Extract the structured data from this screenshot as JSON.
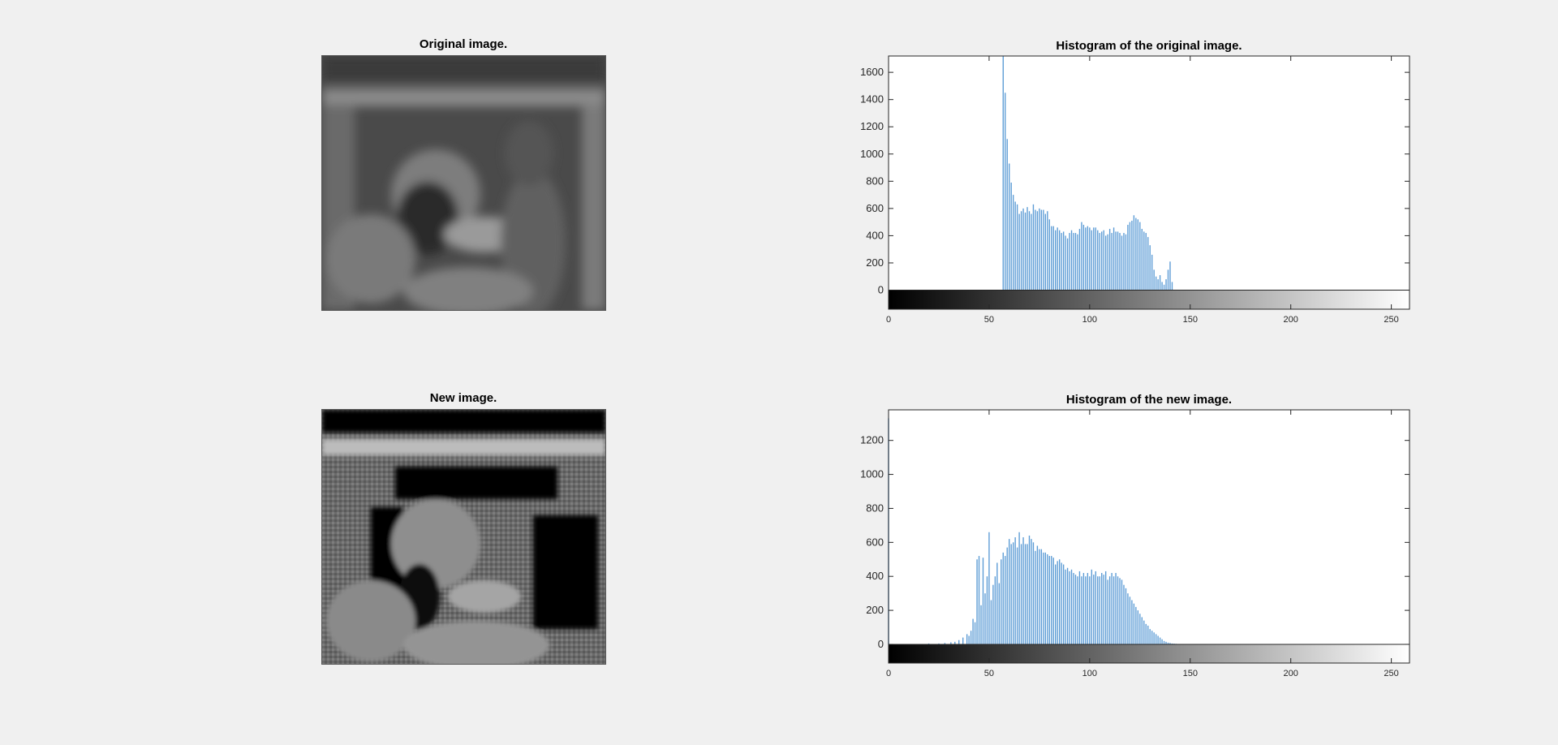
{
  "figure": {
    "original_title": "Original image.",
    "new_title": "New image."
  },
  "chart_data": [
    {
      "type": "bar",
      "title": "Histogram of the original image.",
      "xlabel": "",
      "ylabel": "",
      "xlim": [
        0,
        255
      ],
      "ylim": [
        -140,
        1720
      ],
      "yticks": [
        0,
        200,
        400,
        600,
        800,
        1000,
        1200,
        1400,
        1600
      ],
      "xticks": [
        0,
        50,
        100,
        150,
        200,
        250
      ],
      "bar_color": "#5b9bd5",
      "grid": false,
      "colorbar": "gray (0=black, 255=white)",
      "x": [
        57,
        58,
        59,
        60,
        61,
        62,
        63,
        64,
        65,
        66,
        67,
        68,
        69,
        70,
        71,
        72,
        73,
        74,
        75,
        76,
        77,
        78,
        79,
        80,
        81,
        82,
        83,
        84,
        85,
        86,
        87,
        88,
        89,
        90,
        91,
        92,
        93,
        94,
        95,
        96,
        97,
        98,
        99,
        100,
        101,
        102,
        103,
        104,
        105,
        106,
        107,
        108,
        109,
        110,
        111,
        112,
        113,
        114,
        115,
        116,
        117,
        118,
        119,
        120,
        121,
        122,
        123,
        124,
        125,
        126,
        127,
        128,
        129,
        130,
        131,
        132,
        133,
        134,
        135,
        136,
        137,
        138,
        139,
        140,
        141,
        142,
        143,
        144,
        145,
        146,
        147
      ],
      "values": [
        1720,
        1450,
        1110,
        930,
        790,
        700,
        650,
        630,
        560,
        580,
        600,
        570,
        610,
        580,
        560,
        630,
        590,
        580,
        600,
        590,
        590,
        560,
        580,
        520,
        470,
        470,
        440,
        460,
        440,
        420,
        430,
        400,
        380,
        420,
        440,
        420,
        420,
        410,
        450,
        500,
        480,
        460,
        470,
        460,
        440,
        460,
        460,
        440,
        420,
        430,
        440,
        400,
        410,
        450,
        420,
        460,
        430,
        430,
        420,
        400,
        420,
        410,
        480,
        500,
        510,
        550,
        530,
        520,
        500,
        450,
        430,
        420,
        390,
        330,
        260,
        150,
        100,
        80,
        110,
        60,
        40,
        80,
        150,
        210,
        60
      ]
    },
    {
      "type": "bar",
      "title": "Histogram of the new image.",
      "xlabel": "",
      "ylabel": "",
      "xlim": [
        0,
        255
      ],
      "ylim": [
        -110,
        1380
      ],
      "yticks": [
        0,
        200,
        400,
        600,
        800,
        1000,
        1200
      ],
      "xticks": [
        0,
        50,
        100,
        150,
        200,
        250
      ],
      "bar_color": "#5b9bd5",
      "grid": false,
      "colorbar": "gray (0=black, 255=white)",
      "x": [
        0,
        20,
        25,
        28,
        31,
        33,
        35,
        37,
        39,
        40,
        41,
        42,
        43,
        44,
        45,
        46,
        47,
        48,
        49,
        50,
        51,
        52,
        53,
        54,
        55,
        56,
        57,
        58,
        59,
        60,
        61,
        62,
        63,
        64,
        65,
        66,
        67,
        68,
        69,
        70,
        71,
        72,
        73,
        74,
        75,
        76,
        77,
        78,
        79,
        80,
        81,
        82,
        83,
        84,
        85,
        86,
        87,
        88,
        89,
        90,
        91,
        92,
        93,
        94,
        95,
        96,
        97,
        98,
        99,
        100,
        101,
        102,
        103,
        104,
        105,
        106,
        107,
        108,
        109,
        110,
        111,
        112,
        113,
        114,
        115,
        116,
        117,
        118,
        119,
        120,
        121,
        122,
        123,
        124,
        125,
        126,
        127,
        128,
        129,
        130,
        131,
        132,
        133,
        134,
        135,
        136,
        137,
        138,
        139,
        140,
        141,
        142,
        143,
        144,
        145,
        146,
        147,
        148,
        149,
        150,
        151,
        152,
        153,
        154,
        155,
        156,
        157,
        158,
        159,
        160,
        161,
        162,
        163,
        164,
        165,
        166,
        167,
        168,
        169,
        170
      ],
      "values": [
        1330,
        5,
        5,
        8,
        12,
        15,
        25,
        40,
        60,
        50,
        80,
        150,
        130,
        500,
        520,
        230,
        510,
        300,
        400,
        660,
        260,
        350,
        400,
        480,
        360,
        500,
        540,
        520,
        570,
        620,
        590,
        600,
        630,
        570,
        660,
        590,
        630,
        590,
        590,
        640,
        620,
        600,
        550,
        580,
        560,
        560,
        540,
        540,
        530,
        520,
        520,
        510,
        470,
        490,
        500,
        480,
        470,
        440,
        450,
        430,
        440,
        420,
        410,
        400,
        430,
        400,
        420,
        400,
        420,
        400,
        440,
        410,
        430,
        400,
        400,
        420,
        410,
        430,
        380,
        400,
        420,
        400,
        420,
        400,
        390,
        380,
        350,
        330,
        300,
        280,
        260,
        240,
        220,
        200,
        180,
        160,
        140,
        120,
        110,
        90,
        80,
        70,
        60,
        50,
        40,
        30,
        20,
        15,
        10,
        8,
        5,
        4,
        3,
        2,
        2,
        1,
        1,
        1,
        1,
        1,
        1,
        1,
        1,
        1,
        1,
        1,
        1,
        1,
        1,
        1,
        1,
        1,
        1,
        1,
        1,
        1
      ]
    }
  ]
}
